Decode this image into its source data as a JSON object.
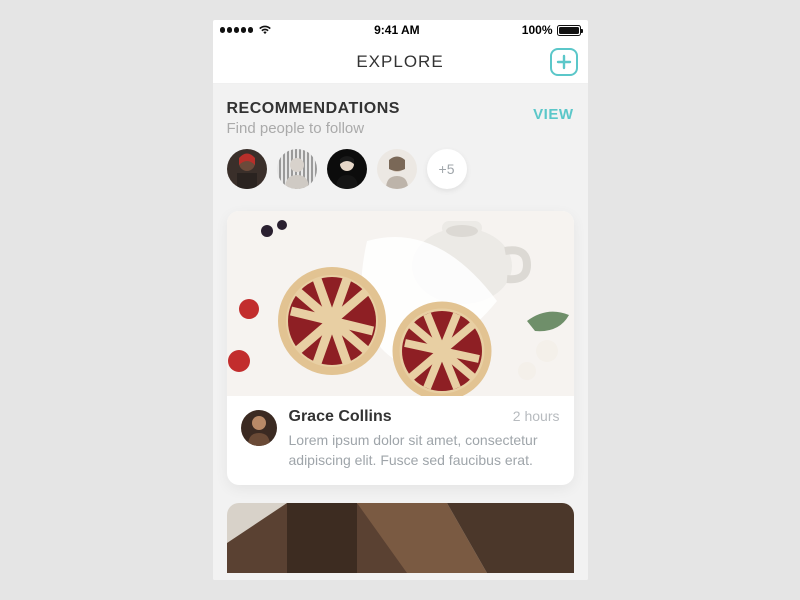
{
  "status": {
    "time": "9:41 AM",
    "battery_pct": "100%"
  },
  "nav": {
    "title": "EXPLORE"
  },
  "recommendations": {
    "title": "RECOMMENDATIONS",
    "subtitle": "Find people to follow",
    "view_label": "VIEW",
    "overflow": "+5"
  },
  "post": {
    "author": "Grace Collins",
    "time": "2 hours",
    "body": "Lorem ipsum dolor sit amet, consectetur adipiscing elit. Fusce sed faucibus erat."
  }
}
